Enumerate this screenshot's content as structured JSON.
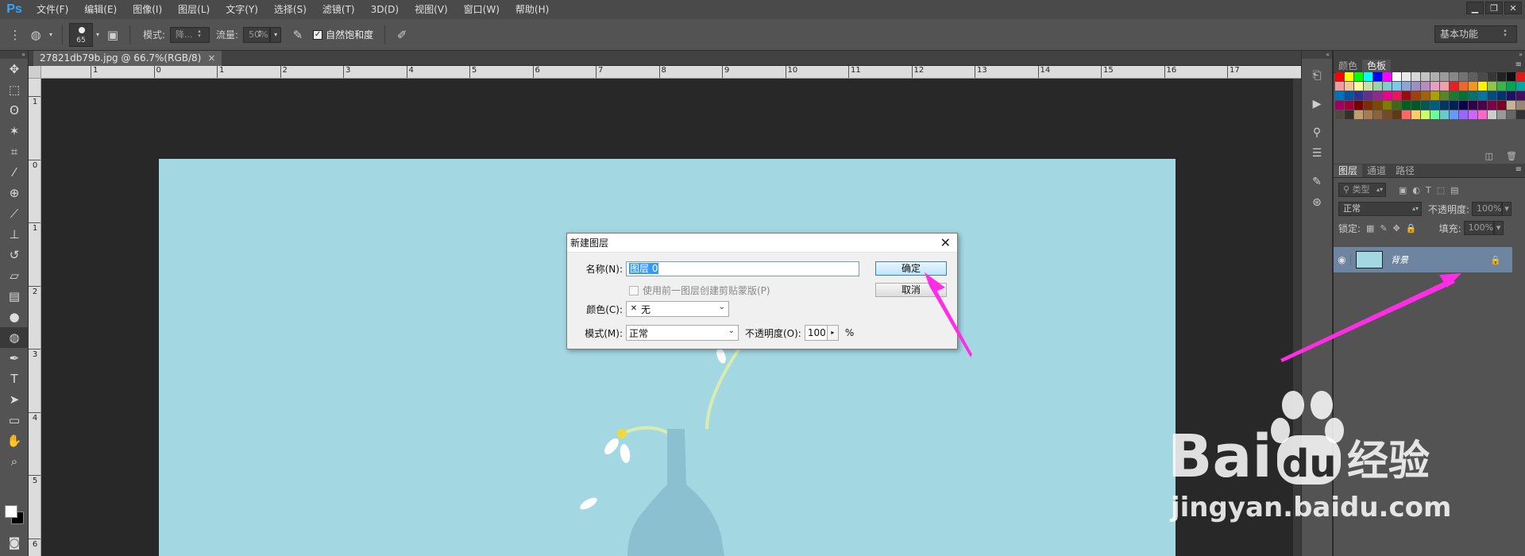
{
  "app": {
    "logo": "Ps"
  },
  "menu": [
    "文件(F)",
    "编辑(E)",
    "图像(I)",
    "图层(L)",
    "文字(Y)",
    "选择(S)",
    "滤镜(T)",
    "3D(D)",
    "视图(V)",
    "窗口(W)",
    "帮助(H)"
  ],
  "options": {
    "brush_size": "65",
    "mode_label": "模式:",
    "mode_value": "降...",
    "flow_label": "流量:",
    "flow_value": "50%",
    "vibrance_label": "自然饱和度",
    "workspace": "基本功能"
  },
  "document": {
    "tab_title": "27821db79b.jpg @ 66.7%(RGB/8)",
    "close": "×"
  },
  "ruler_h": [
    "1",
    "0",
    "1",
    "2",
    "3",
    "4",
    "5",
    "6",
    "7",
    "8",
    "9",
    "10",
    "11",
    "12",
    "13",
    "14",
    "15",
    "16",
    "17"
  ],
  "ruler_v": [
    "1",
    "0",
    "1",
    "2",
    "3",
    "4",
    "5",
    "6"
  ],
  "dialog": {
    "title": "新建图层",
    "close": "✕",
    "name_label": "名称(N):",
    "name_value": "图层 0",
    "clip_label": "使用前一图层创建剪贴蒙版(P)",
    "color_label": "颜色(C):",
    "color_value": "无",
    "mode_label": "模式(M):",
    "mode_value": "正常",
    "opacity_label": "不透明度(O):",
    "opacity_value": "100",
    "opacity_unit": "%",
    "ok": "确定",
    "cancel": "取消"
  },
  "panels": {
    "color_tab": "颜色",
    "swatches_tab": "色板",
    "layers_tab": "图层",
    "channels_tab": "通道",
    "paths_tab": "路径",
    "filter_kind": "类型",
    "blend_mode": "正常",
    "opacity_label": "不透明度:",
    "opacity_value": "100%",
    "lock_label": "锁定:",
    "fill_label": "填充:",
    "fill_value": "100%",
    "layer_name": "背景"
  },
  "swatch_colors": [
    "#ff0000",
    "#ffff00",
    "#00ff00",
    "#00ffff",
    "#0000ff",
    "#ff00ff",
    "#ffffff",
    "#ebebeb",
    "#d7d7d7",
    "#c3c3c3",
    "#afafaf",
    "#9b9b9b",
    "#878787",
    "#737373",
    "#5f5f5f",
    "#4b4b4b",
    "#373737",
    "#232323",
    "#0f0f0f",
    "#e31a1a",
    "#f2e600",
    "#f29c9c",
    "#f7c39b",
    "#fffa9c",
    "#c6e1a6",
    "#9bd2a6",
    "#7fcdce",
    "#7dc8f1",
    "#8ba5d5",
    "#9b8fc5",
    "#b88cc2",
    "#e79ec2",
    "#f1a0a8",
    "#ed1c24",
    "#f26522",
    "#f7941d",
    "#fff200",
    "#8dc63f",
    "#39b54a",
    "#00a651",
    "#00a99d",
    "#00aeef",
    "#0072bc",
    "#0054a6",
    "#2e3192",
    "#662d91",
    "#92278f",
    "#ec008c",
    "#ed145b",
    "#9e0b0f",
    "#a0410d",
    "#a36209",
    "#aba000",
    "#598527",
    "#1a7b30",
    "#007236",
    "#00746b",
    "#0076a3",
    "#004b80",
    "#003471",
    "#1b1464",
    "#440e62",
    "#630460",
    "#9e005d",
    "#9e0039",
    "#790000",
    "#7b2e00",
    "#7d4900",
    "#827b00",
    "#406618",
    "#005e20",
    "#005826",
    "#005952",
    "#005b7f",
    "#003663",
    "#002157",
    "#0d004c",
    "#32004b",
    "#4b0049",
    "#7b0046",
    "#7a0026",
    "#c7b299",
    "#998675",
    "#736357",
    "#534741",
    "#37302a",
    "#c69c6d",
    "#a67c52",
    "#8c6239",
    "#754c24",
    "#603913",
    "#ff6666",
    "#ffcc66",
    "#ccff66",
    "#66ff99",
    "#66cccc",
    "#6699ff",
    "#9966ff",
    "#cc66ff",
    "#ff66cc",
    "#cccccc",
    "#999999",
    "#666666",
    "#333333"
  ]
}
